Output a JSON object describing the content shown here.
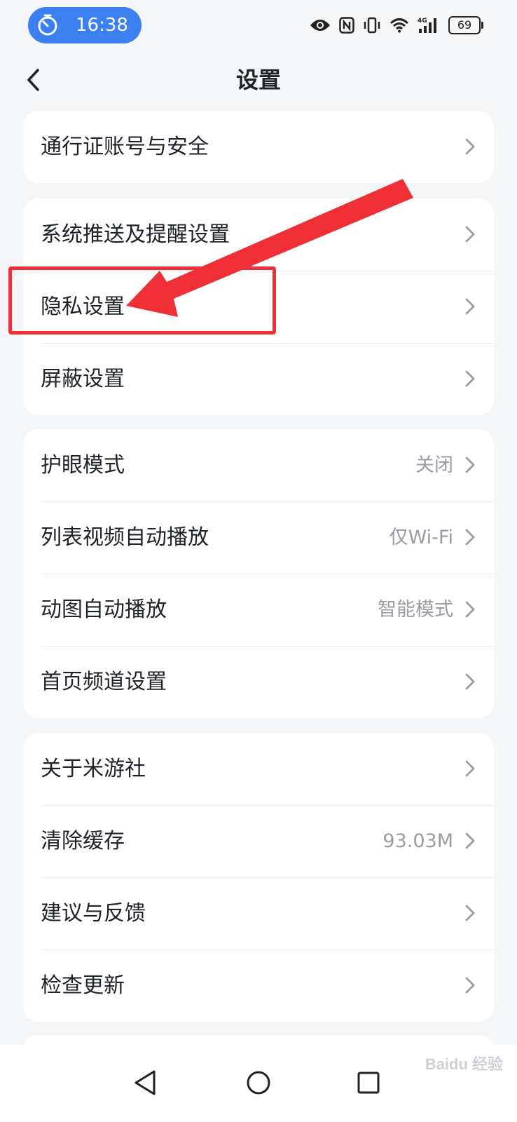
{
  "status_bar": {
    "time": "16:38",
    "battery": "69",
    "network": "4G"
  },
  "header": {
    "title": "设置"
  },
  "groups": [
    {
      "items": [
        {
          "label": "通行证账号与安全",
          "value": ""
        }
      ]
    },
    {
      "items": [
        {
          "label": "系统推送及提醒设置",
          "value": ""
        },
        {
          "label": "隐私设置",
          "value": ""
        },
        {
          "label": "屏蔽设置",
          "value": ""
        }
      ]
    },
    {
      "items": [
        {
          "label": "护眼模式",
          "value": "关闭"
        },
        {
          "label": "列表视频自动播放",
          "value": "仅Wi-Fi"
        },
        {
          "label": "动图自动播放",
          "value": "智能模式"
        },
        {
          "label": "首页频道设置",
          "value": ""
        }
      ]
    },
    {
      "items": [
        {
          "label": "关于米游社",
          "value": ""
        },
        {
          "label": "清除缓存",
          "value": "93.03M"
        },
        {
          "label": "建议与反馈",
          "value": ""
        },
        {
          "label": "检查更新",
          "value": ""
        }
      ]
    }
  ],
  "annotation": {
    "color": "#ef2f36"
  },
  "watermark": "Baidu 经验",
  "colors": {
    "accent": "#3b7ff0",
    "background": "#f5f6f8",
    "secondary_text": "#9a9ca3"
  }
}
